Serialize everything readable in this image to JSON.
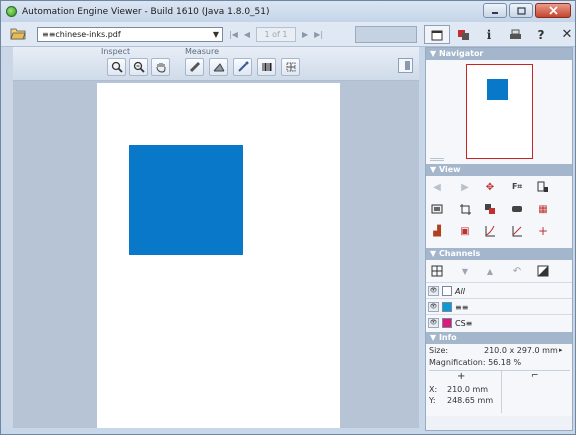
{
  "window": {
    "title": "Automation Engine Viewer - Build 1610 (Java 1.8.0_51)"
  },
  "toolbar": {
    "file_name": "≡≡chinese-inks.pdf",
    "page_indicator": "1 of 1"
  },
  "subtoolbar": {
    "inspect_label": "Inspect",
    "measure_label": "Measure"
  },
  "panels": {
    "navigator": "Navigator",
    "view": "View",
    "channels": "Channels",
    "info": "Info"
  },
  "channels": {
    "rows": [
      {
        "name": "All",
        "color": "#ffffff"
      },
      {
        "name": "≡≡",
        "color": "#0a9ad8"
      },
      {
        "name": "CS≡",
        "color": "#e0187c"
      }
    ]
  },
  "info": {
    "size_label": "Size:",
    "size_value": "210.0 x 297.0 mm",
    "magnification": "Magnification: 56.18 %",
    "x_label": "X:",
    "x_value": "210.0 mm",
    "y_label": "Y:",
    "y_value": "248.65 mm"
  },
  "colors": {
    "artwork_blue": "#0a78c8",
    "navigator_frame": "#c82424"
  }
}
